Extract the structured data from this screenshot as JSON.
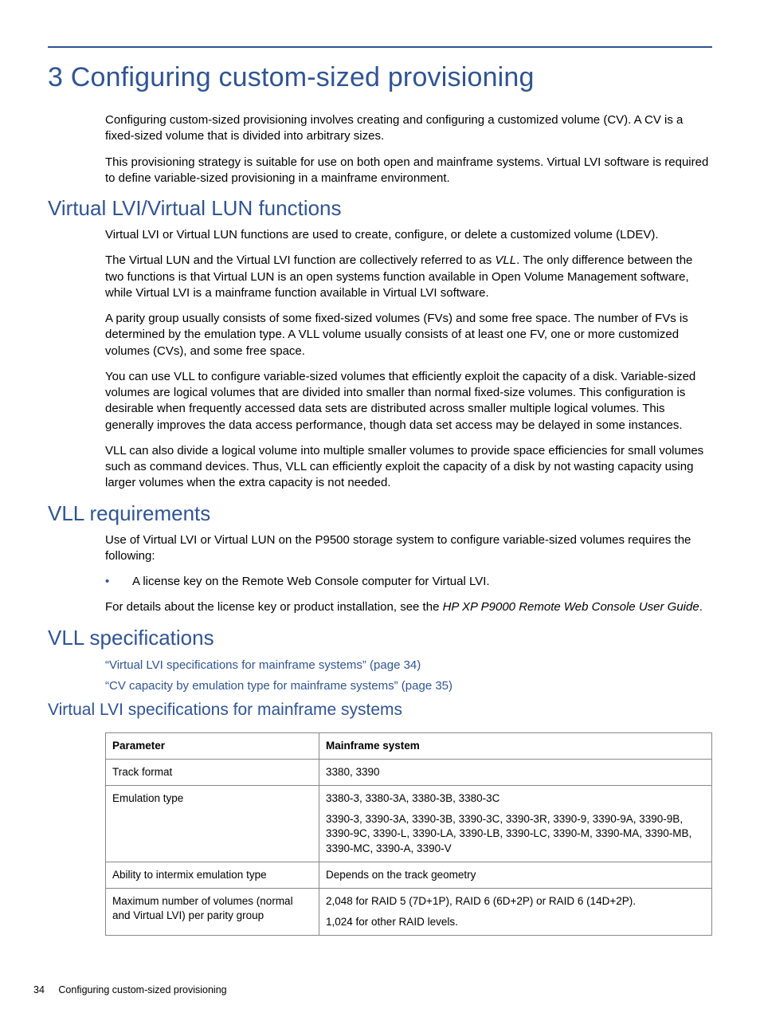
{
  "headings": {
    "h1": "3 Configuring custom-sized provisioning",
    "h2a": "Virtual LVI/Virtual LUN functions",
    "h2b": "VLL requirements",
    "h2c": "VLL specifications",
    "h3a": "Virtual LVI specifications for mainframe systems"
  },
  "intro": {
    "p1": "Configuring custom-sized provisioning involves creating and configuring a customized volume (CV). A CV is a fixed-sized volume that is divided into arbitrary sizes.",
    "p2": "This provisioning strategy is suitable for use on both open and mainframe systems. Virtual LVI software is required to define variable-sized provisioning in a mainframe environment."
  },
  "funcs": {
    "p1": "Virtual LVI or Virtual LUN functions are used to create, configure, or delete a customized volume (LDEV).",
    "p2a": "The Virtual LUN and the Virtual LVI function are collectively referred to as ",
    "p2b": "VLL",
    "p2c": ". The only difference between the two functions is that Virtual LUN is an open systems function available in Open Volume Management software, while Virtual LVI is a mainframe function available in Virtual LVI software.",
    "p3": "A parity group usually consists of some fixed-sized volumes (FVs) and some free space. The number of FVs is determined by the emulation type. A VLL volume usually consists of at least one FV, one or more customized volumes (CVs), and some free space.",
    "p4": "You can use VLL to configure variable-sized volumes that efficiently exploit the capacity of a disk. Variable-sized volumes are logical volumes that are divided into smaller than normal fixed-size volumes. This configuration is desirable when frequently accessed data sets are distributed across smaller multiple logical volumes. This generally improves the data access performance, though data set access may be delayed in some instances.",
    "p5": "VLL can also divide a logical volume into multiple smaller volumes to provide space efficiencies for small volumes such as command devices. Thus, VLL can efficiently exploit the capacity of a disk by not wasting capacity using larger volumes when the extra capacity is not needed."
  },
  "reqs": {
    "p1": "Use of Virtual LVI or Virtual LUN on the P9500 storage system to configure variable-sized volumes requires the following:",
    "b1": "A license key on the Remote Web Console computer for Virtual LVI.",
    "p2a": "For details about the license key or product installation, see the ",
    "p2b": "HP XP P9000 Remote Web Console User Guide",
    "p2c": "."
  },
  "specs": {
    "x1": "“Virtual LVI specifications for mainframe systems” (page 34)",
    "x2": "“CV capacity by emulation type for mainframe systems” (page 35)"
  },
  "table": {
    "h_param": "Parameter",
    "h_main": "Mainframe system",
    "r1p": "Track format",
    "r1v": "3380, 3390",
    "r2p": "Emulation type",
    "r2v1": "3380-3, 3380-3A, 3380-3B, 3380-3C",
    "r2v2": "3390-3, 3390-3A, 3390-3B, 3390-3C, 3390-3R, 3390-9, 3390-9A, 3390-9B, 3390-9C, 3390-L, 3390-LA, 3390-LB, 3390-LC, 3390-M, 3390-MA, 3390-MB, 3390-MC, 3390-A, 3390-V",
    "r3p": "Ability to intermix emulation type",
    "r3v": "Depends on the track geometry",
    "r4p": "Maximum number of volumes (normal and Virtual LVI) per parity group",
    "r4v1": "2,048 for RAID 5 (7D+1P), RAID 6 (6D+2P) or RAID 6 (14D+2P).",
    "r4v2": "1,024 for other RAID levels."
  },
  "footer": {
    "page": "34",
    "title": "Configuring custom-sized provisioning"
  }
}
